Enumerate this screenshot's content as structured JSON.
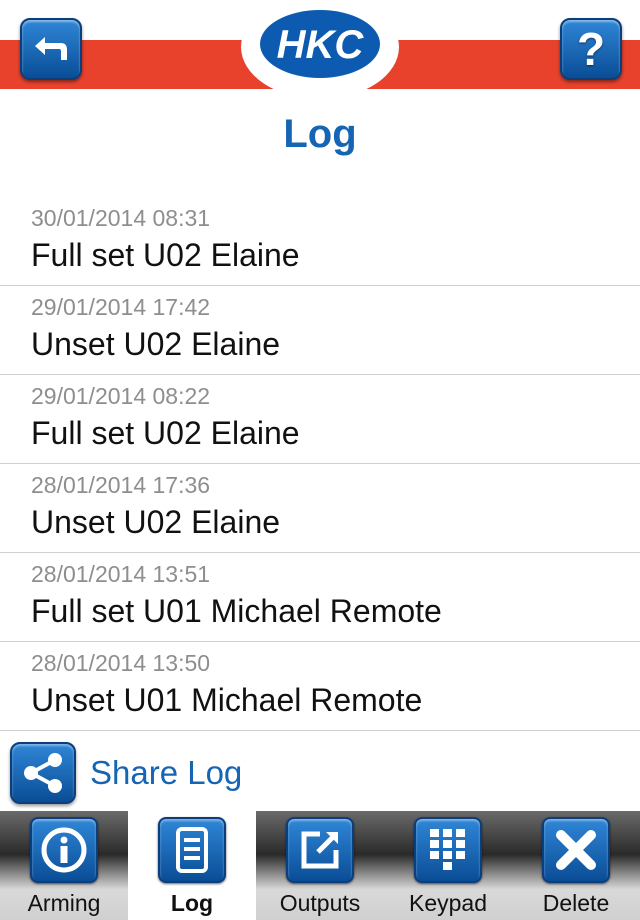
{
  "header": {
    "logo_text": "HKC",
    "title": "Log",
    "back_icon": "back-arrow-icon",
    "help_icon": "question-mark-icon",
    "help_symbol": "?",
    "brand_red": "#e8422c",
    "brand_blue": "#1664b4"
  },
  "log": {
    "entries": [
      {
        "time": "30/01/2014 08:31",
        "event": "Full set U02 Elaine"
      },
      {
        "time": "29/01/2014 17:42",
        "event": "Unset U02 Elaine"
      },
      {
        "time": "29/01/2014 08:22",
        "event": "Full set U02 Elaine"
      },
      {
        "time": "28/01/2014 17:36",
        "event": "Unset U02 Elaine"
      },
      {
        "time": "28/01/2014 13:51",
        "event": "Full set U01 Michael Remote"
      },
      {
        "time": "28/01/2014 13:50",
        "event": "Unset U01 Michael Remote"
      }
    ]
  },
  "share": {
    "label": "Share Log",
    "icon": "share-icon"
  },
  "tabs": [
    {
      "label": "Arming",
      "icon": "info-icon",
      "active": false
    },
    {
      "label": "Log",
      "icon": "document-icon",
      "active": true
    },
    {
      "label": "Outputs",
      "icon": "edit-square-icon",
      "active": false
    },
    {
      "label": "Keypad",
      "icon": "keypad-grid-icon",
      "active": false
    },
    {
      "label": "Delete",
      "icon": "delete-x-icon",
      "active": false
    }
  ]
}
